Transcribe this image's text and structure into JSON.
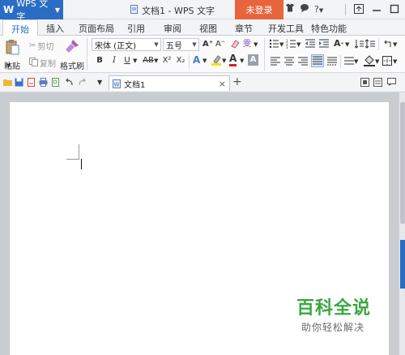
{
  "titlebar": {
    "app_logo": "W",
    "app_name": "WPS 文字",
    "doc_title": "文档1 - WPS 文字",
    "login_button": "未登录",
    "help": "?"
  },
  "tabs": [
    {
      "label": "开始",
      "active": true
    },
    {
      "label": "插入"
    },
    {
      "label": "页面布局"
    },
    {
      "label": "引用"
    },
    {
      "label": "审阅"
    },
    {
      "label": "视图"
    },
    {
      "label": "章节"
    },
    {
      "label": "开发工具"
    },
    {
      "label": "特色功能"
    }
  ],
  "ribbon": {
    "paste": "粘贴",
    "cut": "剪切",
    "copy": "复制",
    "format_painter": "格式刷",
    "font_name": "宋体 (正文)",
    "font_size": "五号",
    "bold": "B",
    "italic": "I",
    "underline": "U",
    "strike": "AB",
    "superscript": "X²",
    "subscript": "X₂",
    "grow_font": "A⁺",
    "shrink_font": "A⁻",
    "phonetic": "雯",
    "text_effect": "A",
    "font_color": "A",
    "char_shading": "A"
  },
  "doctab": {
    "label": "文档1",
    "close": "×"
  },
  "new_tab": "+",
  "watermark": {
    "logo": "百科全说",
    "sub": "助你轻松解决"
  },
  "colors": {
    "accent": "#2b6cc4",
    "login": "#e8643c",
    "watermark_green": "#3aa83f"
  }
}
